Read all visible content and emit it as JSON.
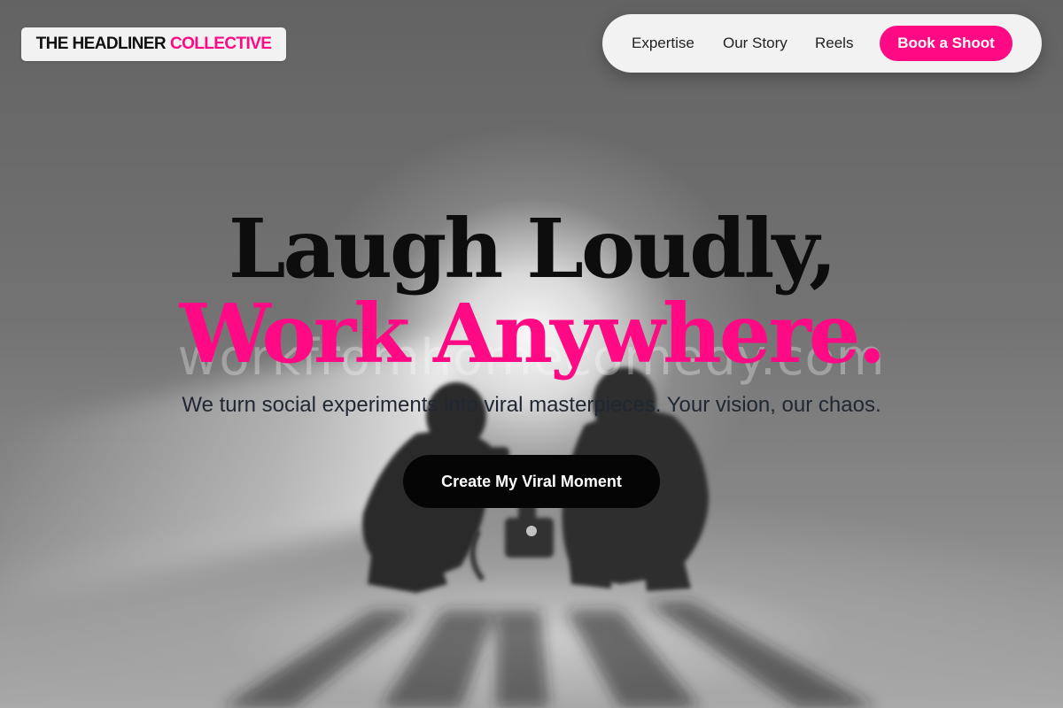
{
  "brand": {
    "name_part1": "THE HEADLINER",
    "name_part2": "COLLECTIVE",
    "accent_color": "#ff0a84"
  },
  "nav": {
    "links": [
      "Expertise",
      "Our Story",
      "Reels"
    ],
    "cta_label": "Book a Shoot"
  },
  "hero": {
    "headline_line1": "Laugh Loudly,",
    "headline_line2": "Work Anywhere.",
    "watermark": "workfromhomecomedy.com",
    "subtitle": "We turn social experiments into viral masterpieces. Your vision, our chaos.",
    "cta_label": "Create My Viral Moment",
    "background": "grayscale-film-crew-photo"
  }
}
